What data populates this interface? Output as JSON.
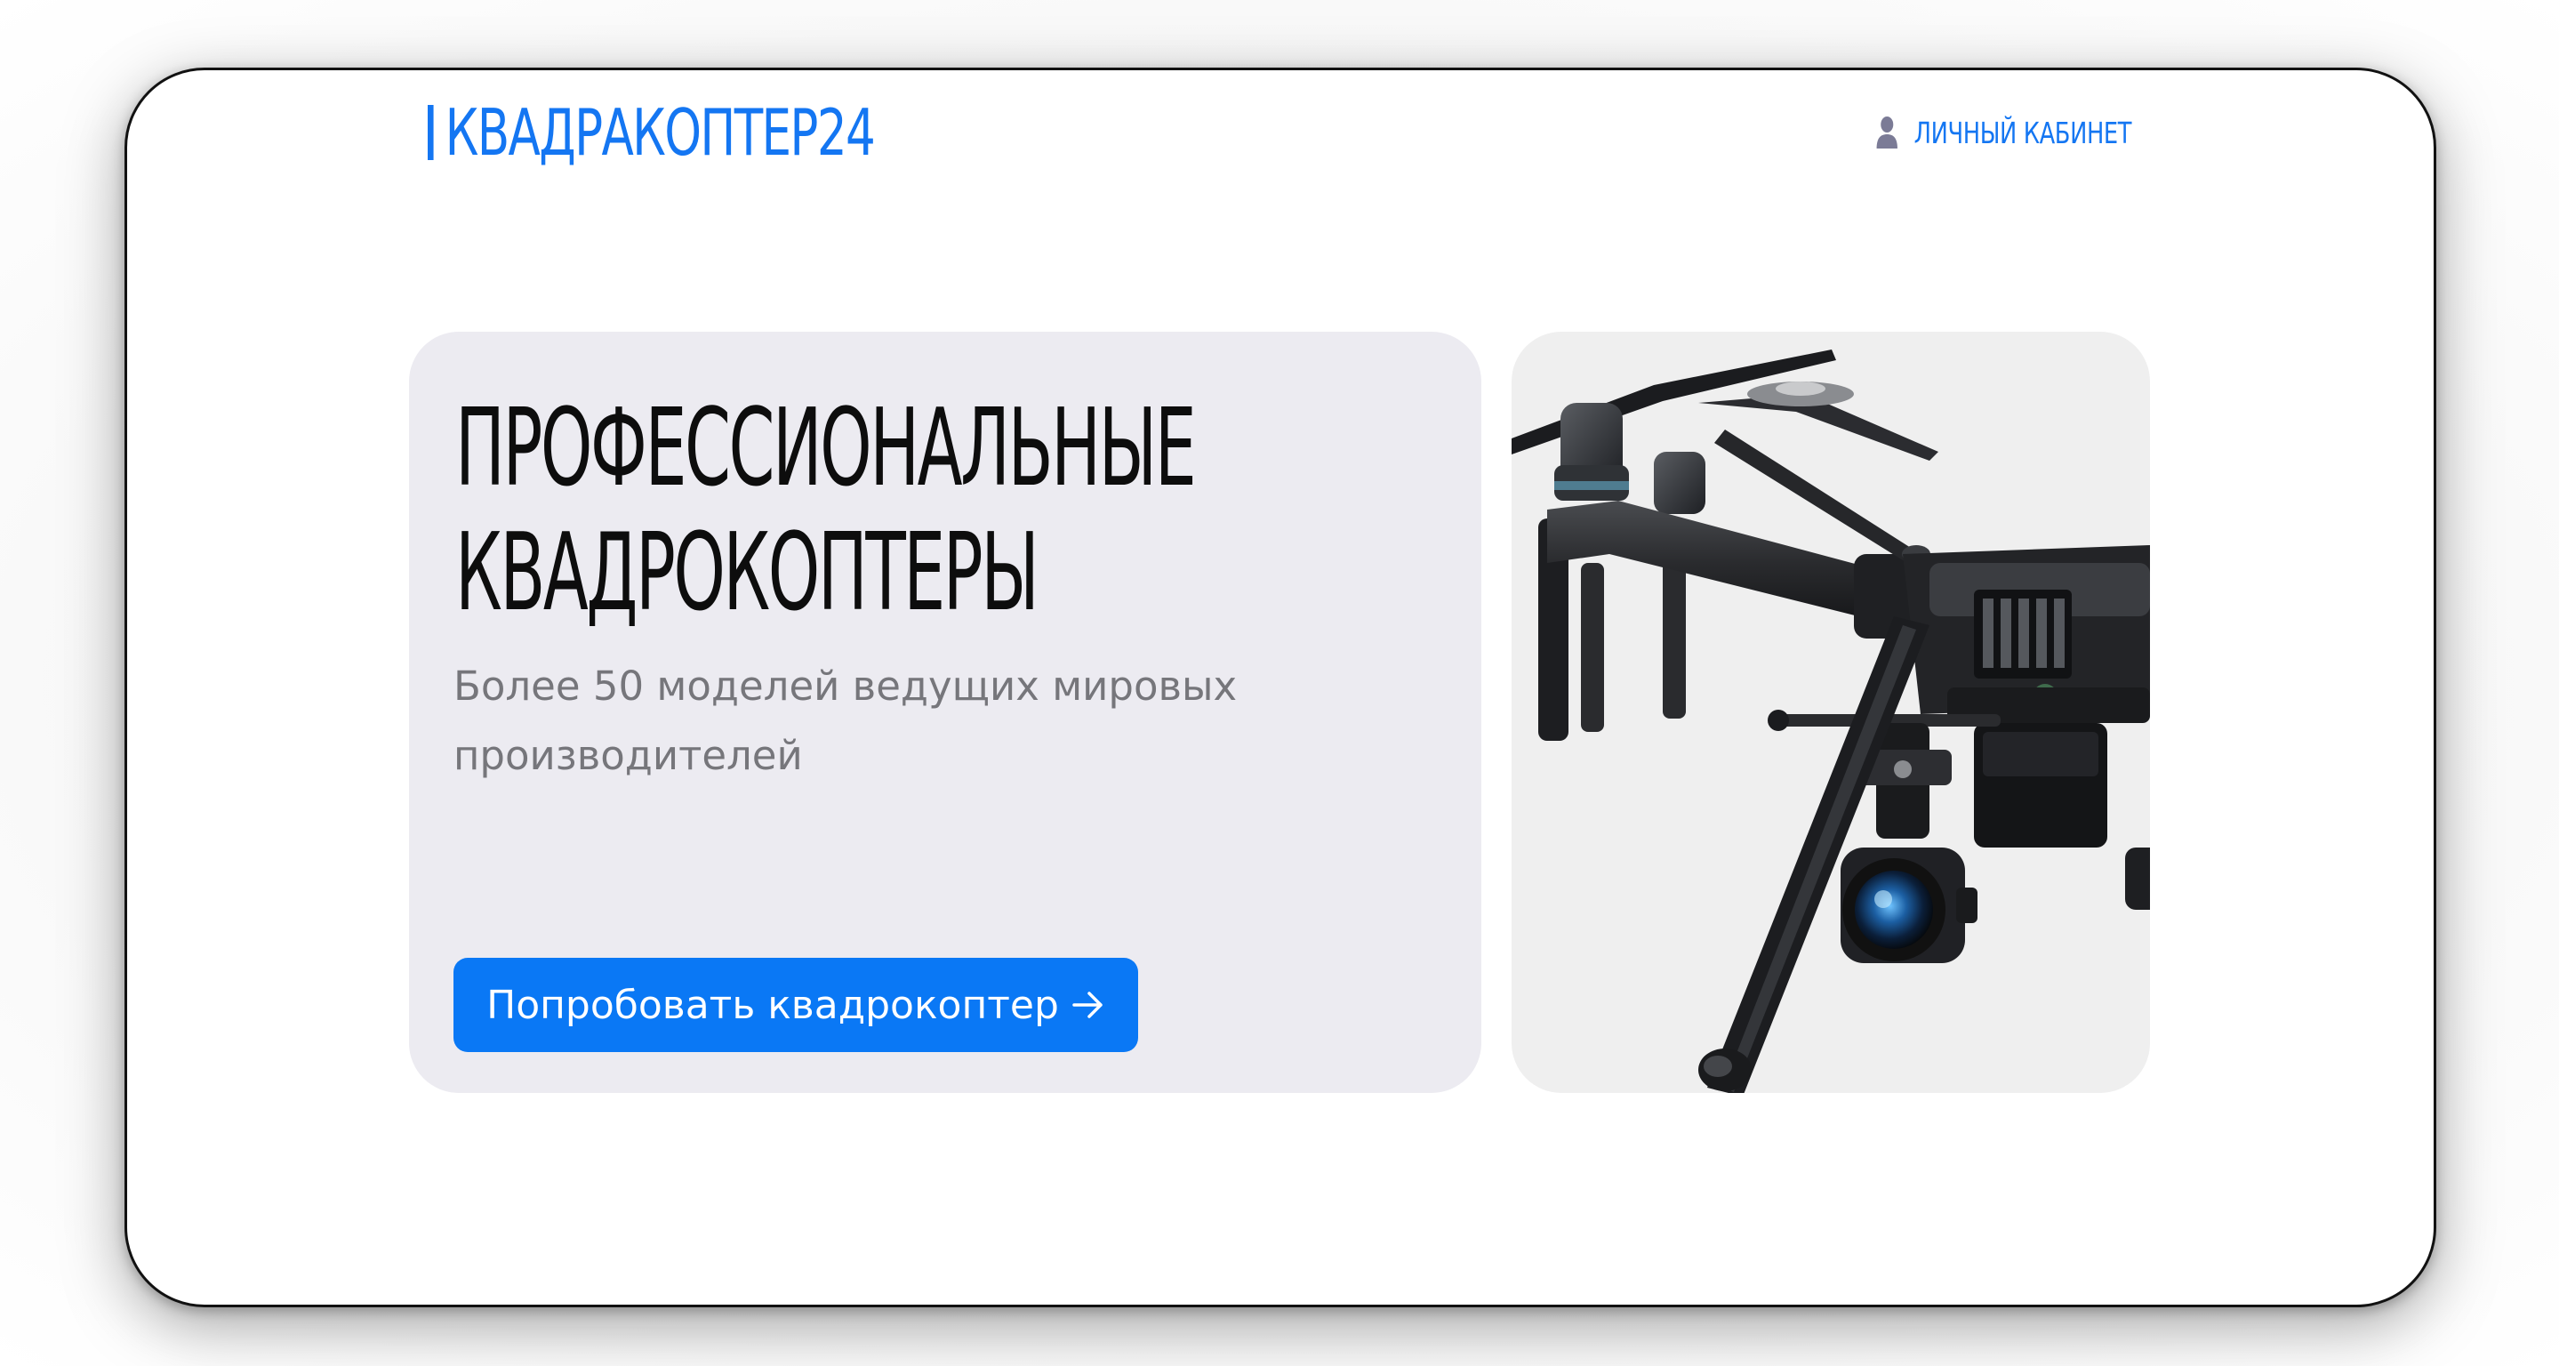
{
  "header": {
    "logo_text": "КВАДРАКОПТЕР24",
    "account_label": "ЛИЧНЫЙ КАБИНЕТ",
    "account_icon": "user-icon"
  },
  "hero": {
    "title_line1": "ПРОФЕССИОНАЛЬНЫЕ",
    "title_line2": "КВАДРОКОПТЕРЫ",
    "subtitle_line1": "Более 50 моделей ведущих мировых",
    "subtitle_line2": "производителей",
    "cta_label": "Попробовать квадрокоптер",
    "cta_icon": "arrow-right-icon"
  },
  "image": {
    "subject": "drone-icon"
  },
  "colors": {
    "accent": "#0a78f5",
    "logo": "#1476f2",
    "hero_card_bg": "#ecebf1",
    "image_card_bg": "#efefef",
    "subtitle": "#76767b"
  }
}
